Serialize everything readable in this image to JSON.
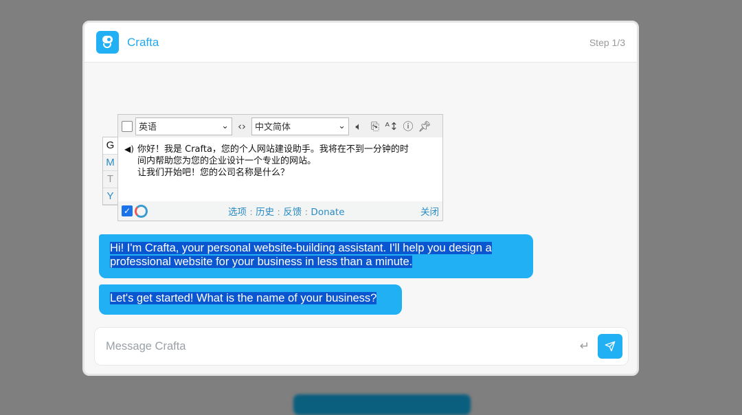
{
  "header": {
    "brand": "Crafta",
    "step": "Step 1/3"
  },
  "translator": {
    "source_lang": "英语",
    "target_lang": "中文简体",
    "tabs": [
      "G",
      "M",
      "T",
      "Y"
    ],
    "text_lines": [
      "你好！我是 Crafta，您的个人网站建设助手。我将在不到一分钟的时",
      "间内帮助您为您的企业设计一个专业的网站。",
      "让我们开始吧！您的公司名称是什么？"
    ],
    "footer_links": [
      "选项",
      "历史",
      "反馈",
      "Donate"
    ],
    "close": "关闭"
  },
  "messages": [
    {
      "role": "assistant",
      "text": "Hi! I'm Crafta, your personal website-building assistant. I'll help you design a professional website for your business in less than a minute."
    },
    {
      "role": "assistant",
      "text": "Let's get started! What is the name of your business?"
    }
  ],
  "composer": {
    "placeholder": "Message Crafta",
    "value": ""
  },
  "colors": {
    "accent": "#22b0f5",
    "selection": "#0a56d0"
  }
}
